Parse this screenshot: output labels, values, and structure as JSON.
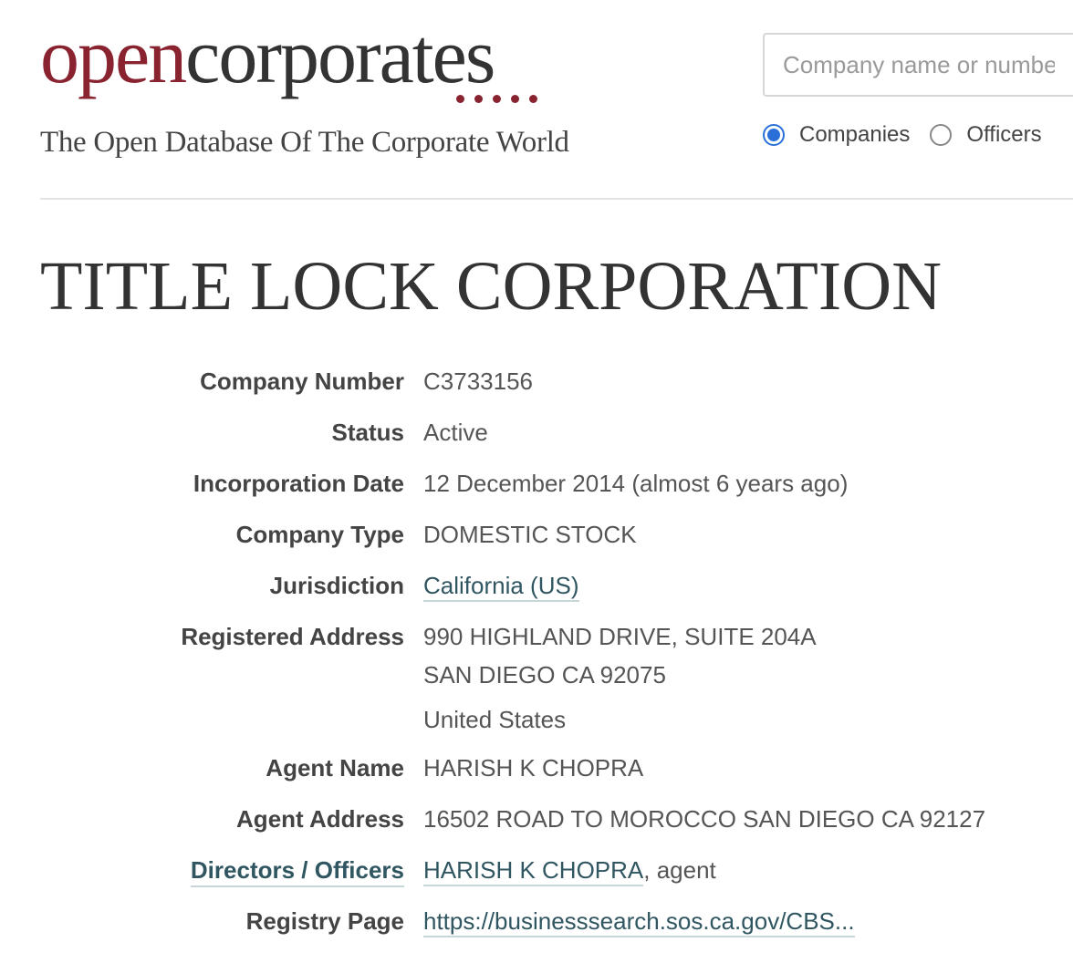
{
  "header": {
    "logo_open": "open",
    "logo_corporates": "corporates",
    "tagline": "The Open Database Of The Corporate World",
    "brand_color": "#8a2330"
  },
  "search": {
    "placeholder": "Company name or number",
    "options": [
      {
        "label": "Companies",
        "selected": true
      },
      {
        "label": "Officers",
        "selected": false
      }
    ]
  },
  "company": {
    "name": "TITLE LOCK CORPORATION",
    "attributes": {
      "company_number_label": "Company Number",
      "company_number": "C3733156",
      "status_label": "Status",
      "status": "Active",
      "incorporation_date_label": "Incorporation Date",
      "incorporation_date": "12 December 2014 (almost 6 years ago)",
      "company_type_label": "Company Type",
      "company_type": "DOMESTIC STOCK",
      "jurisdiction_label": "Jurisdiction",
      "jurisdiction": "California (US)",
      "registered_address_label": "Registered Address",
      "registered_address_line1": "990 HIGHLAND DRIVE, SUITE 204A",
      "registered_address_line2": "SAN DIEGO CA 92075",
      "registered_address_country": "United States",
      "agent_name_label": "Agent Name",
      "agent_name": "HARISH K CHOPRA",
      "agent_address_label": "Agent Address",
      "agent_address": "16502 ROAD TO MOROCCO SAN DIEGO CA 92127",
      "directors_label": "Directors / Officers",
      "director_name": "HARISH K CHOPRA",
      "director_role": ", agent",
      "registry_page_label": "Registry Page",
      "registry_page": "https://businesssearch.sos.ca.gov/CBS..."
    }
  }
}
